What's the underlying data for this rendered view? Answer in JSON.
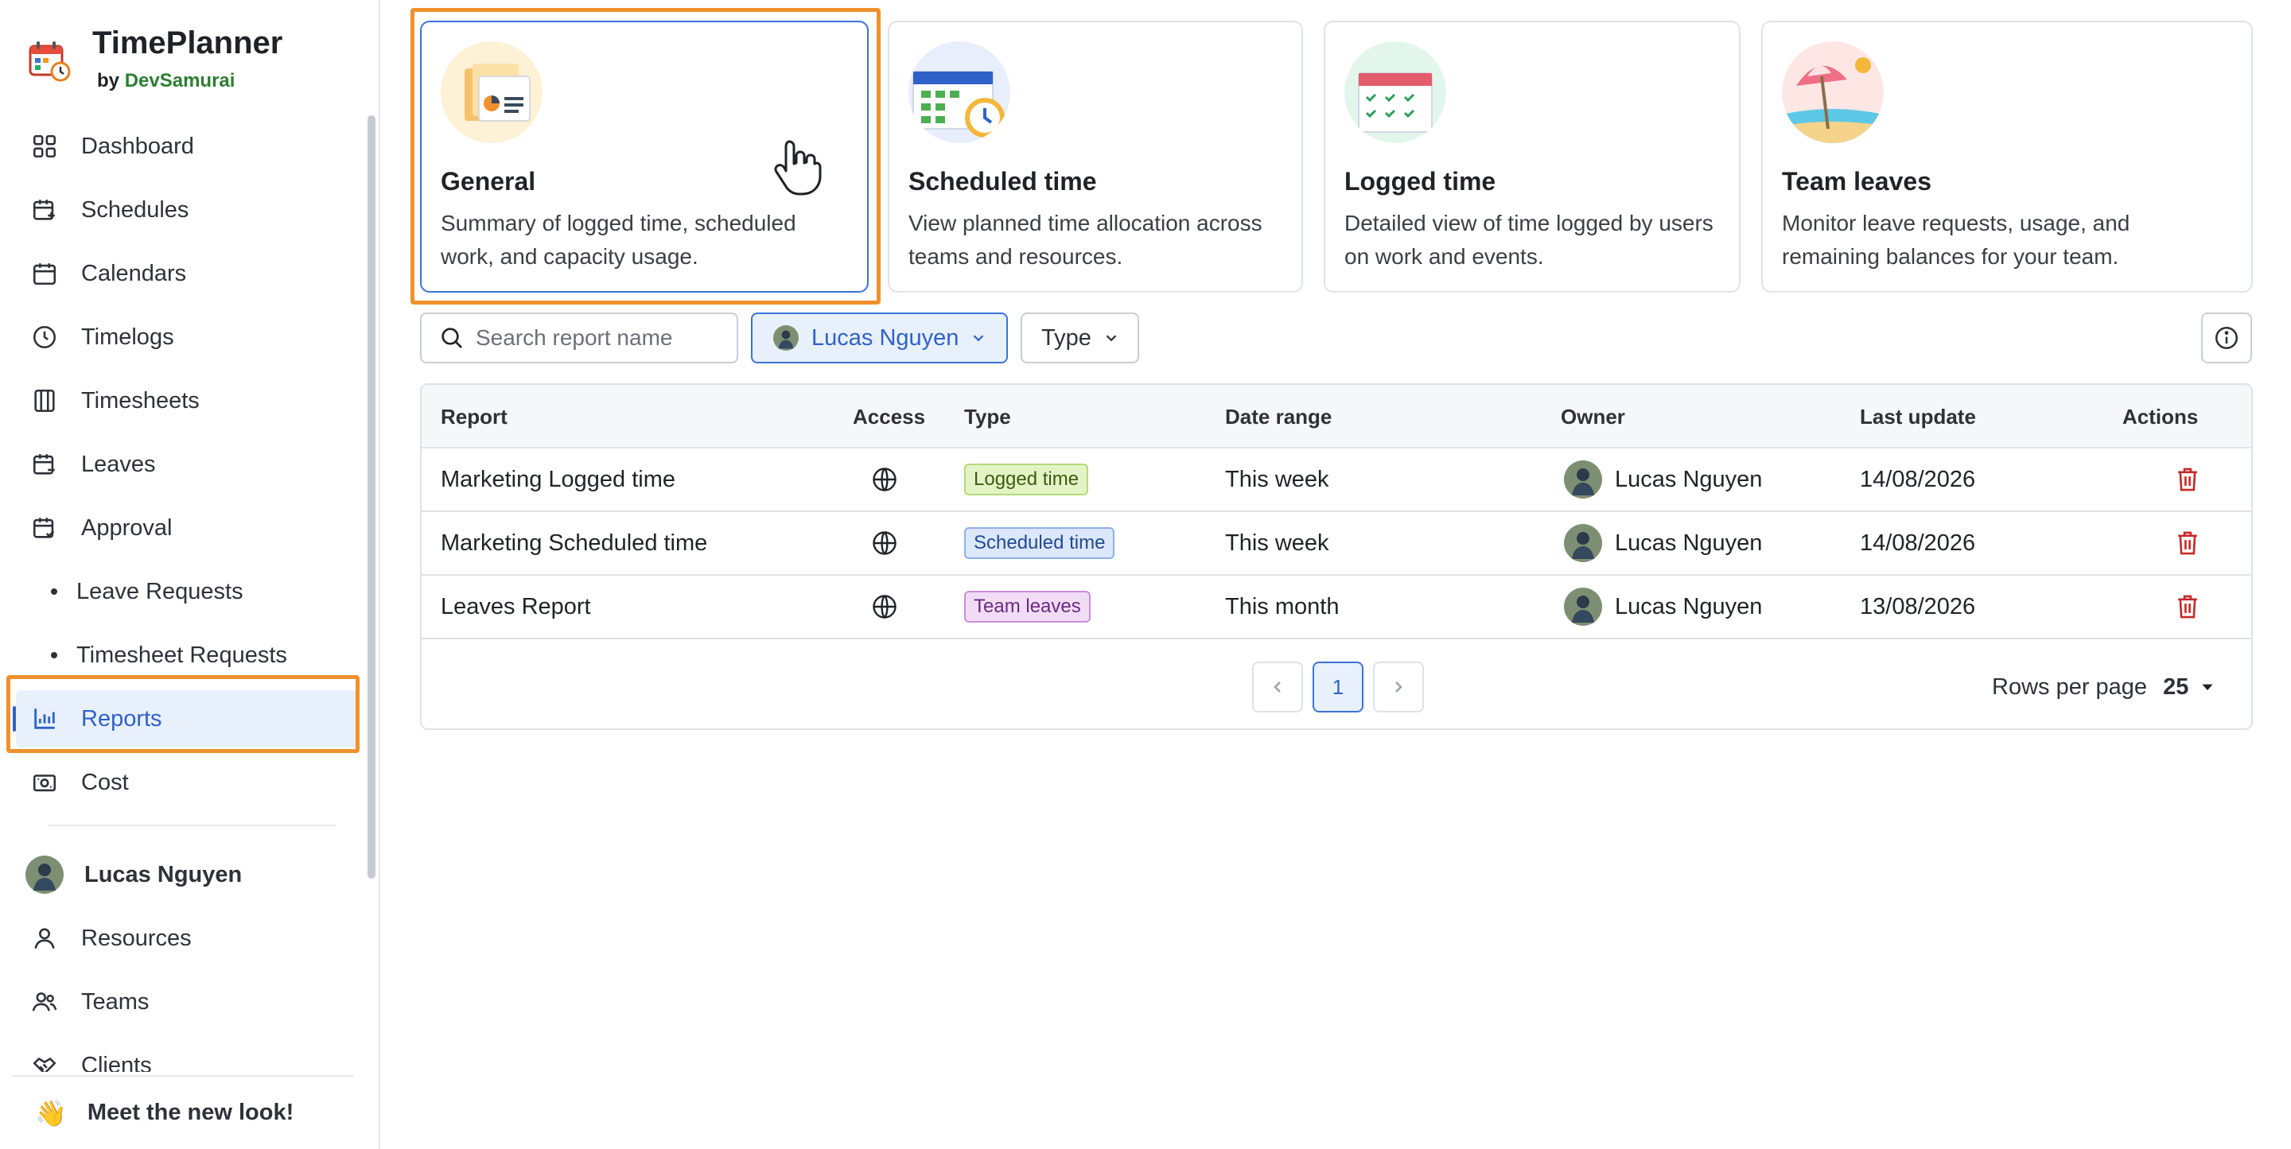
{
  "brand": {
    "name": "TimePlanner",
    "by": "by",
    "company": "DevSamurai"
  },
  "sidebar": {
    "items": [
      {
        "label": "Dashboard"
      },
      {
        "label": "Schedules"
      },
      {
        "label": "Calendars"
      },
      {
        "label": "Timelogs"
      },
      {
        "label": "Timesheets"
      },
      {
        "label": "Leaves"
      },
      {
        "label": "Approval"
      },
      {
        "label": "Leave Requests"
      },
      {
        "label": "Timesheet Requests"
      },
      {
        "label": "Reports"
      },
      {
        "label": "Cost"
      }
    ],
    "user": {
      "name": "Lucas Nguyen"
    },
    "lower_items": [
      {
        "label": "Resources"
      },
      {
        "label": "Teams"
      },
      {
        "label": "Clients"
      }
    ],
    "announcement": {
      "emoji": "👋",
      "label": "Meet the new look!"
    }
  },
  "report_types": [
    {
      "title": "General",
      "desc": "Summary of logged time, scheduled work, and capacity usage."
    },
    {
      "title": "Scheduled time",
      "desc": "View planned time allocation across teams and resources."
    },
    {
      "title": "Logged time",
      "desc": "Detailed view of time logged by users on work and events."
    },
    {
      "title": "Team leaves",
      "desc": "Monitor leave requests, usage, and remaining balances for your team."
    }
  ],
  "filters": {
    "search_placeholder": "Search report name",
    "owner": "Lucas Nguyen",
    "type": "Type"
  },
  "table": {
    "headers": [
      "Report",
      "Access",
      "Type",
      "Date range",
      "Owner",
      "Last update",
      "Actions"
    ],
    "rows": [
      {
        "report": "Marketing Logged time",
        "type": "Logged time",
        "date_range": "This week",
        "owner": "Lucas Nguyen",
        "last_update": "14/08/2026"
      },
      {
        "report": "Marketing Scheduled time",
        "type": "Scheduled time",
        "date_range": "This week",
        "owner": "Lucas Nguyen",
        "last_update": "14/08/2026"
      },
      {
        "report": "Leaves Report",
        "type": "Team leaves",
        "date_range": "This month",
        "owner": "Lucas Nguyen",
        "last_update": "13/08/2026"
      }
    ],
    "pagination": {
      "current_page": "1",
      "rows_per_page_label": "Rows per page",
      "rows_per_page": "25"
    }
  },
  "colors": {
    "accent": "#2f62c8",
    "highlight": "#f0912d",
    "badge_logged": "#e3f3c5",
    "badge_scheduled": "#dbe7fb",
    "badge_leaves": "#f1dcf6",
    "danger": "#c62828"
  }
}
